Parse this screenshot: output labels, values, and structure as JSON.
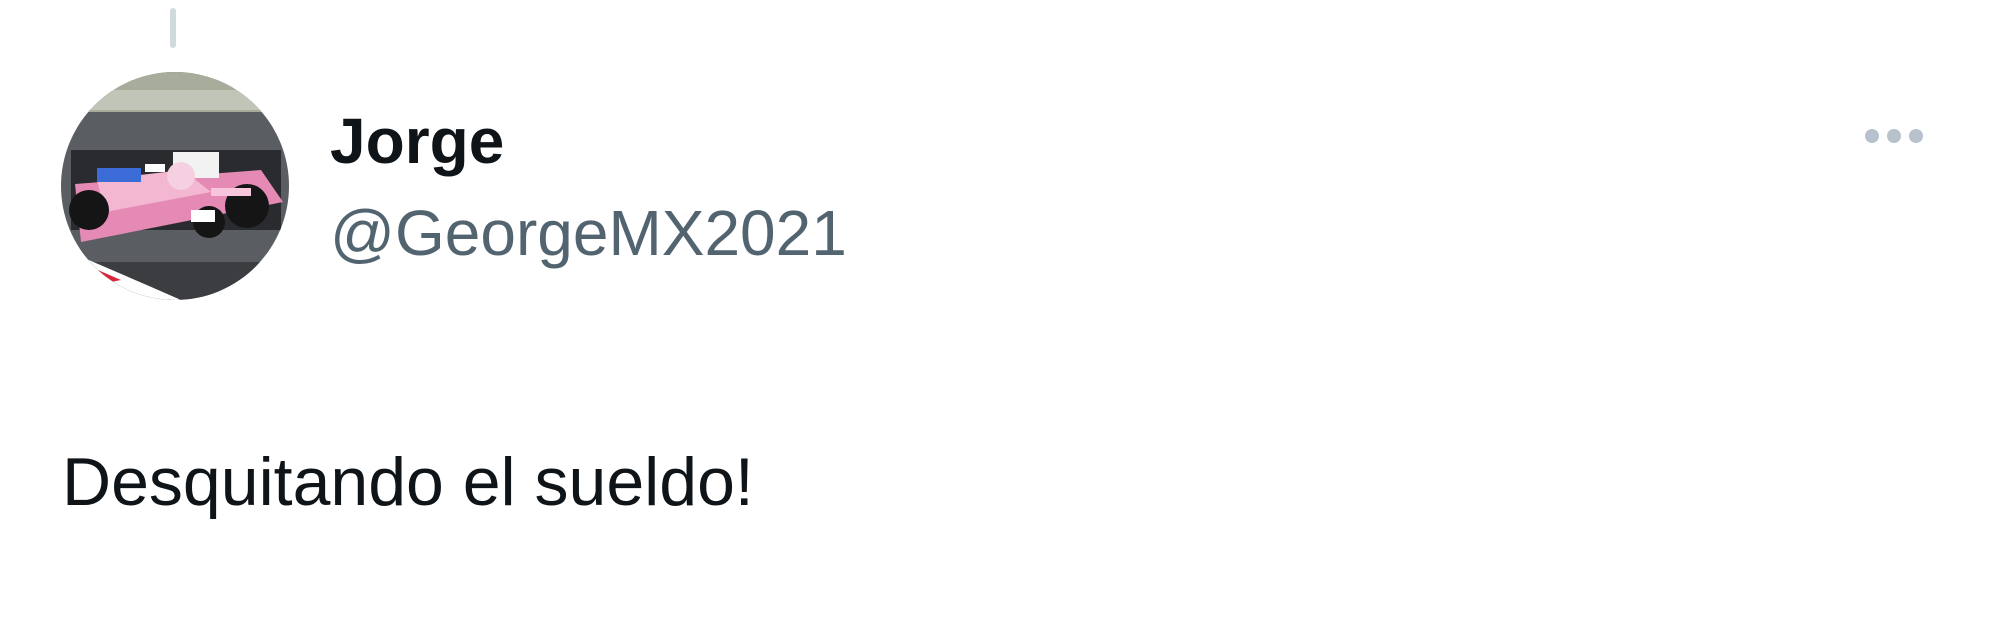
{
  "tweet": {
    "author": {
      "display_name": "Jorge",
      "handle": "@GeorgeMX2021",
      "avatar_icon": "f1-racing-car-avatar"
    },
    "text": "Desquitando el sueldo!",
    "more_icon": "more-horizontal-icon"
  },
  "colors": {
    "text_primary": "#0f1419",
    "text_secondary": "#536471",
    "thread_line": "#cfd9de",
    "more_dots": "#b8c2cc",
    "car_pink": "#e58ab4",
    "car_blue": "#3b6bd6"
  }
}
